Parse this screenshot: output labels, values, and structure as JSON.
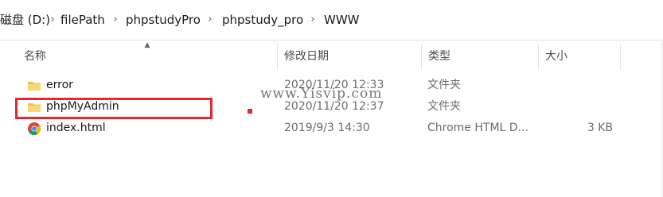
{
  "breadcrumb": [
    "磁盘 (D:)",
    "filePath",
    "phpstudyPro",
    "phpstudy_pro",
    "WWW"
  ],
  "columns": {
    "name": "名称",
    "date": "修改日期",
    "type": "类型",
    "size": "大小"
  },
  "files": [
    {
      "name": "error",
      "date": "2020/11/20 12:33",
      "type": "文件夹",
      "size": "",
      "icon": "folder-icon"
    },
    {
      "name": "phpMyAdmin",
      "date": "2020/11/20 12:37",
      "type": "文件夹",
      "size": "",
      "icon": "folder-icon"
    },
    {
      "name": "index.html",
      "date": "2019/9/3 14:30",
      "type": "Chrome HTML D...",
      "size": "3 KB",
      "icon": "chrome-icon"
    }
  ],
  "watermark": "www.Yisvip.com",
  "colors": {
    "highlight": "#e8262b",
    "folder": "#f3c04a"
  }
}
